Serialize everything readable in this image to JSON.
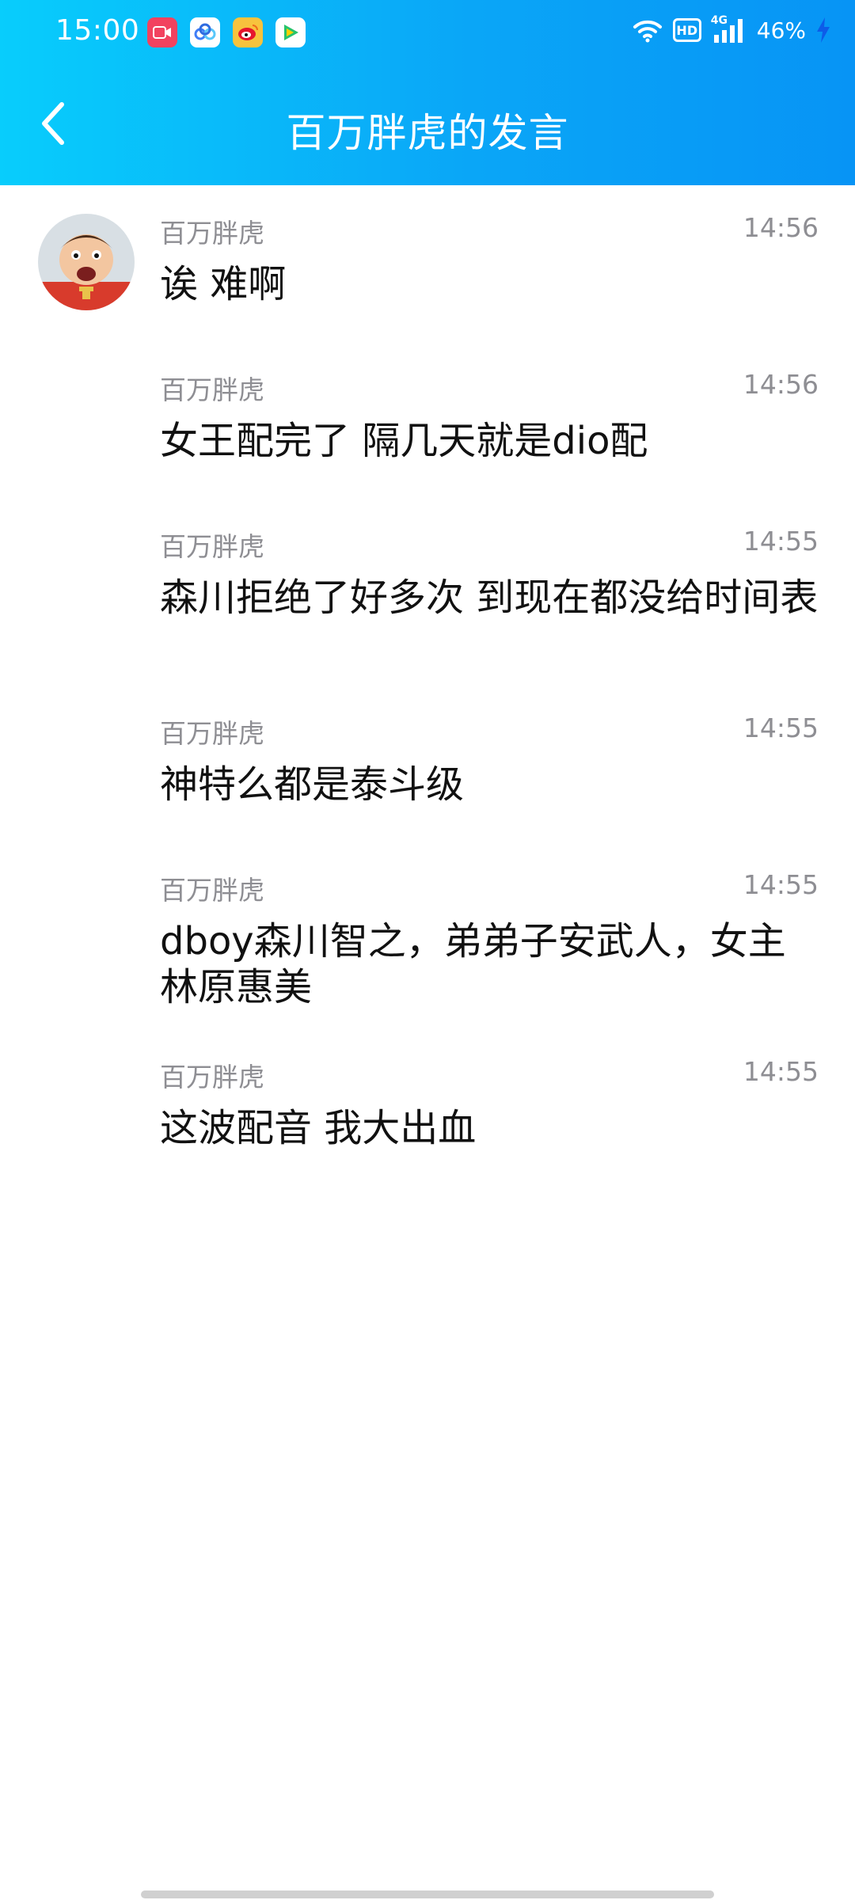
{
  "status_bar": {
    "time": "15:00",
    "app_icons": [
      "screen-recorder-icon",
      "baidu-netdisk-icon",
      "weibo-icon",
      "video-player-icon"
    ],
    "hd": "HD",
    "network": "4G",
    "battery": "46%"
  },
  "header": {
    "title": "百万胖虎的发言",
    "back_icon": "chevron-left-icon"
  },
  "messages": [
    {
      "sender": "百万胖虎",
      "time": "14:56",
      "text": "诶 难啊",
      "has_avatar": true
    },
    {
      "sender": "百万胖虎",
      "time": "14:56",
      "text": "女王配完了 隔几天就是dio配"
    },
    {
      "sender": "百万胖虎",
      "time": "14:55",
      "text": "森川拒绝了好多次 到现在都没给时间表"
    },
    {
      "sender": "百万胖虎",
      "time": "14:55",
      "text": "神特么都是泰斗级"
    },
    {
      "sender": "百万胖虎",
      "time": "14:55",
      "text": "dboy森川智之，弟弟子安武人，女主林原惠美"
    },
    {
      "sender": "百万胖虎",
      "time": "14:55",
      "text": "这波配音 我大出血"
    }
  ],
  "colors": {
    "header_start": "#08cdfc",
    "header_end": "#0794f5",
    "meta_text": "#8e8e93",
    "message_text": "#111111"
  }
}
